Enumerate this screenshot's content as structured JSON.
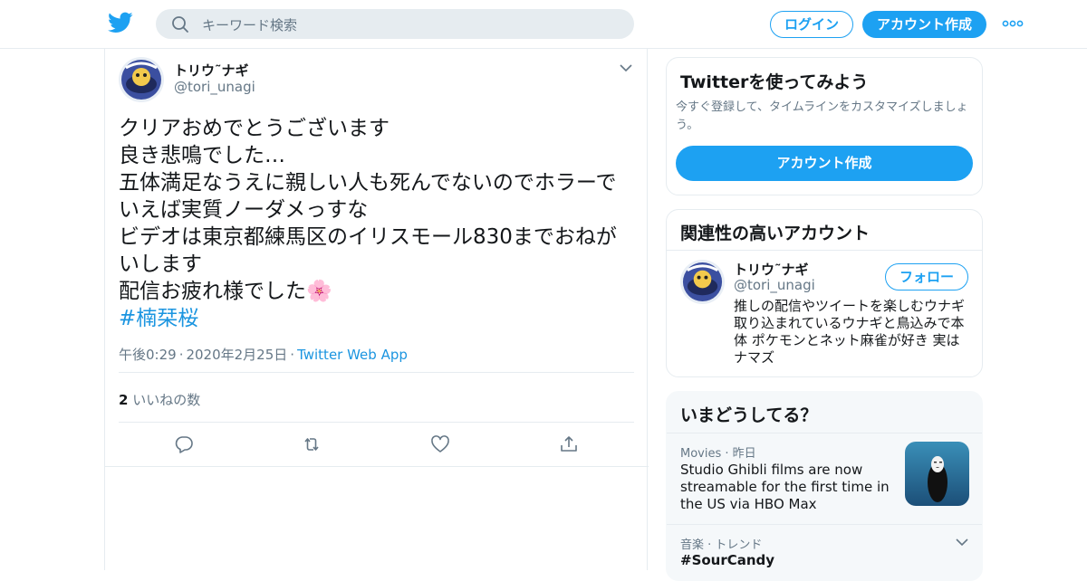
{
  "header": {
    "search_placeholder": "キーワード検索",
    "login_label": "ログイン",
    "signup_label": "アカウント作成"
  },
  "tweet": {
    "author_name": "トリウ˜ナギ",
    "author_handle": "@tori_unagi",
    "lines": [
      "クリアおめでとうございます",
      "良き悲鳴でした…",
      "五体満足なうえに親しい人も死んでないのでホラーで",
      "いえば実質ノーダメっすな",
      "ビデオは東京都練馬区のイリスモール830までおねが",
      "いします",
      "配信お疲れ様でした🌸"
    ],
    "hashtag": "#楠栞桜",
    "time": "午後0:29",
    "date": "2020年2月25日",
    "source": "Twitter Web App",
    "like_count": "2",
    "like_label": "いいねの数"
  },
  "sidebar": {
    "signup_card": {
      "title": "Twitterを使ってみよう",
      "description": "今すぐ登録して、タイムラインをカスタマイズしましょう。",
      "button": "アカウント作成"
    },
    "related_card": {
      "title": "関連性の高いアカウント",
      "name": "トリウ˜ナギ",
      "handle": "@tori_unagi",
      "follow_label": "フォロー",
      "bio": "推しの配信やツイートを楽しむウナギ 取り込まれているウナギと鳥込みで本体 ポケモンとネット麻雀が好き 実はナマズ"
    },
    "trends_card": {
      "title": "いまどうしてる？",
      "trends": [
        {
          "category": "Movies",
          "time": "昨日",
          "title": "Studio Ghibli films are now streamable for the first time in the US via HBO Max"
        },
        {
          "category": "音楽 · トレンド",
          "title": "#SourCandy"
        }
      ]
    }
  },
  "colors": {
    "accent": "#1da1f2",
    "link": "#1b95e0",
    "muted": "#657786",
    "border": "#e6ecf0"
  }
}
